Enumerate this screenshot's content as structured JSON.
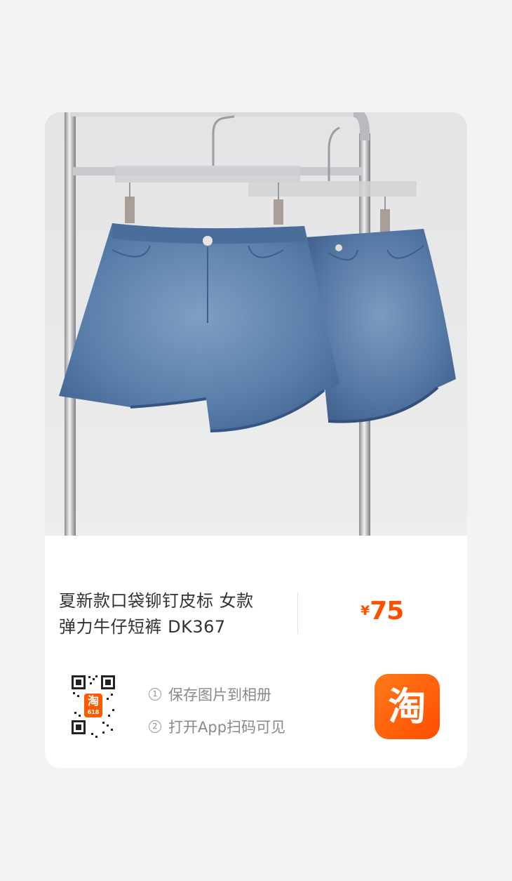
{
  "product": {
    "title_line1": "夏新款口袋铆钉皮标 女款",
    "title_line2": "弹力牛仔短裤 DK367",
    "price_symbol": "¥",
    "price": "75"
  },
  "share": {
    "step1_num": "1",
    "step1": "保存图片到相册",
    "step2_num": "2",
    "step2": "打开App扫码可见",
    "qr_badge_char": "淘",
    "qr_badge_sub": "618",
    "logo_char": "淘"
  },
  "colors": {
    "price": "#ff5000",
    "logo_gradient_start": "#ff7a1a",
    "logo_gradient_end": "#ff4d00"
  },
  "icons": [
    "qr-code-icon",
    "taobao-logo-icon"
  ]
}
